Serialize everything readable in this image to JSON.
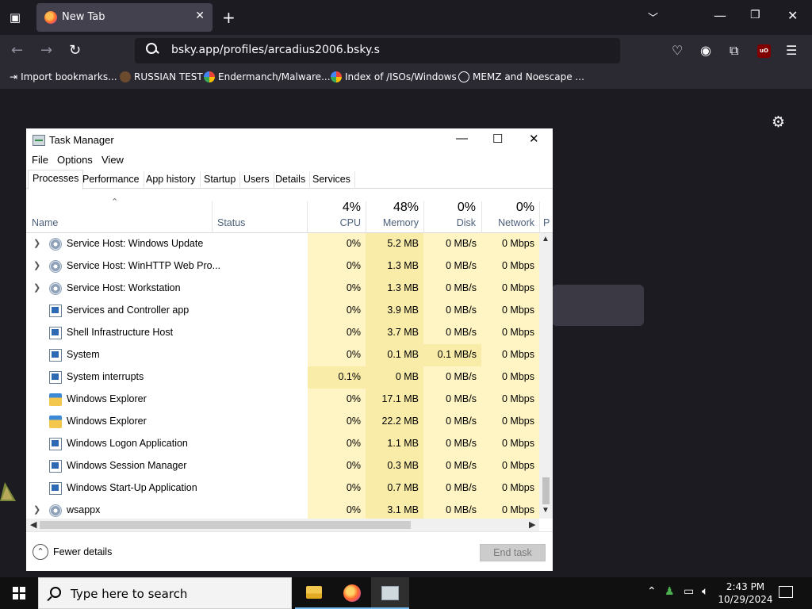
{
  "browser": {
    "tab_title": "New Tab",
    "url": "bsky.app/profiles/arcadius2006.bsky.s",
    "bookmarks": [
      "Import bookmarks...",
      "RUSSIAN TEST",
      "Endermanch/Malware...",
      "Index of /ISOs/Windows",
      "MEMZ and Noescape ..."
    ]
  },
  "taskmgr": {
    "title": "Task Manager",
    "menu": [
      "File",
      "Options",
      "View"
    ],
    "tabs": [
      "Processes",
      "Performance",
      "App history",
      "Startup",
      "Users",
      "Details",
      "Services"
    ],
    "active_tab": "Processes",
    "columns": {
      "name": "Name",
      "status": "Status",
      "cpu": {
        "pct": "4%",
        "label": "CPU"
      },
      "memory": {
        "pct": "48%",
        "label": "Memory"
      },
      "disk": {
        "pct": "0%",
        "label": "Disk"
      },
      "network": {
        "pct": "0%",
        "label": "Network"
      },
      "power_partial": "P"
    },
    "rows": [
      {
        "name": "Service Host: Windows Update",
        "expandable": true,
        "icon": "gear-icon",
        "cpu": "0%",
        "memory": "5.2 MB",
        "disk": "0 MB/s",
        "network": "0 Mbps"
      },
      {
        "name": "Service Host: WinHTTP Web Pro...",
        "expandable": true,
        "icon": "gear-icon",
        "cpu": "0%",
        "memory": "1.3 MB",
        "disk": "0 MB/s",
        "network": "0 Mbps"
      },
      {
        "name": "Service Host: Workstation",
        "expandable": true,
        "icon": "gear-icon",
        "cpu": "0%",
        "memory": "1.3 MB",
        "disk": "0 MB/s",
        "network": "0 Mbps"
      },
      {
        "name": "Services and Controller app",
        "expandable": false,
        "icon": "window-icon",
        "cpu": "0%",
        "memory": "3.9 MB",
        "disk": "0 MB/s",
        "network": "0 Mbps"
      },
      {
        "name": "Shell Infrastructure Host",
        "expandable": false,
        "icon": "window-icon",
        "cpu": "0%",
        "memory": "3.7 MB",
        "disk": "0 MB/s",
        "network": "0 Mbps"
      },
      {
        "name": "System",
        "expandable": false,
        "icon": "window-icon",
        "cpu": "0%",
        "memory": "0.1 MB",
        "disk": "0.1 MB/s",
        "network": "0 Mbps",
        "disk_hot": true
      },
      {
        "name": "System interrupts",
        "expandable": false,
        "icon": "window-icon",
        "cpu": "0.1%",
        "memory": "0 MB",
        "disk": "0 MB/s",
        "network": "0 Mbps",
        "cpu_hot": true
      },
      {
        "name": "Windows Explorer",
        "expandable": false,
        "icon": "folder-icon",
        "cpu": "0%",
        "memory": "17.1 MB",
        "disk": "0 MB/s",
        "network": "0 Mbps"
      },
      {
        "name": "Windows Explorer",
        "expandable": false,
        "icon": "folder-icon",
        "cpu": "0%",
        "memory": "22.2 MB",
        "disk": "0 MB/s",
        "network": "0 Mbps"
      },
      {
        "name": "Windows Logon Application",
        "expandable": false,
        "icon": "window-icon",
        "cpu": "0%",
        "memory": "1.1 MB",
        "disk": "0 MB/s",
        "network": "0 Mbps"
      },
      {
        "name": "Windows Session Manager",
        "expandable": false,
        "icon": "window-icon",
        "cpu": "0%",
        "memory": "0.3 MB",
        "disk": "0 MB/s",
        "network": "0 Mbps"
      },
      {
        "name": "Windows Start-Up Application",
        "expandable": false,
        "icon": "window-icon",
        "cpu": "0%",
        "memory": "0.7 MB",
        "disk": "0 MB/s",
        "network": "0 Mbps"
      },
      {
        "name": "wsappx",
        "expandable": true,
        "icon": "gear-icon",
        "cpu": "0%",
        "memory": "3.1 MB",
        "disk": "0 MB/s",
        "network": "0 Mbps"
      }
    ],
    "fewer_details": "Fewer details",
    "end_task": "End task"
  },
  "taskbar": {
    "search_placeholder": "Type here to search",
    "time": "2:43 PM",
    "date": "10/29/2024"
  }
}
